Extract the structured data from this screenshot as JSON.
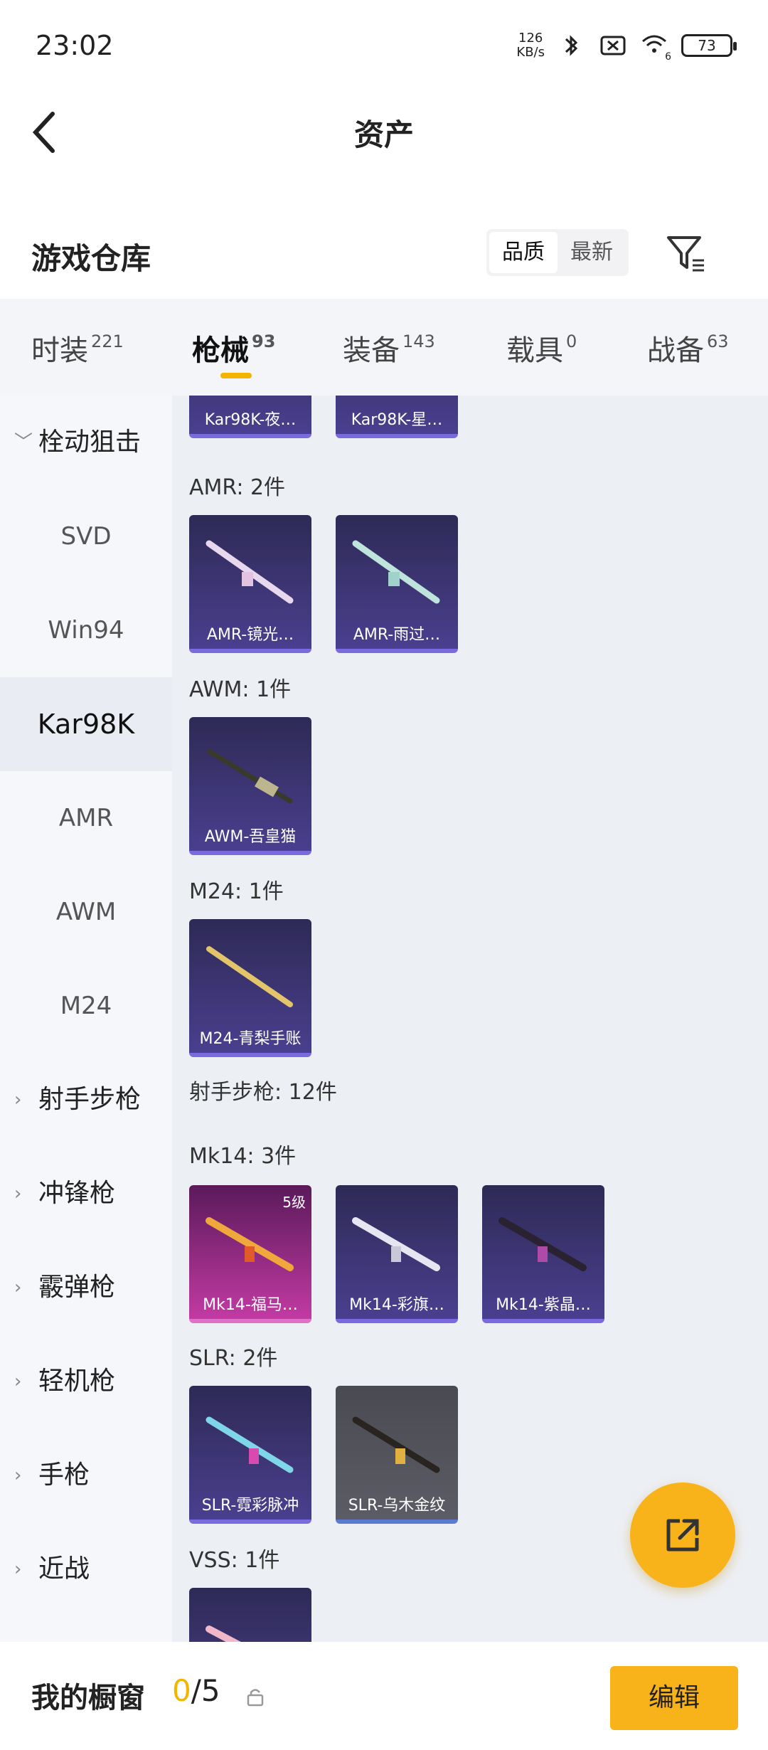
{
  "status_bar": {
    "time": "23:02",
    "net_speed_value": "126",
    "net_speed_unit": "KB/s",
    "wifi_suffix": "6",
    "battery": "73"
  },
  "nav": {
    "title": "资产"
  },
  "section": {
    "title": "游戏仓库",
    "sort_options": [
      "品质",
      "最新"
    ]
  },
  "tabs": [
    {
      "label": "时装",
      "count": "221"
    },
    {
      "label": "枪械",
      "count": "93"
    },
    {
      "label": "装备",
      "count": "143"
    },
    {
      "label": "载具",
      "count": "0"
    },
    {
      "label": "战备",
      "count": "63"
    }
  ],
  "sidebar": {
    "items": [
      {
        "label": "栓动狙击",
        "group": true
      },
      {
        "label": "SVD"
      },
      {
        "label": "Win94"
      },
      {
        "label": "Kar98K",
        "selected": true
      },
      {
        "label": "AMR"
      },
      {
        "label": "AWM"
      },
      {
        "label": "M24"
      },
      {
        "label": "射手步枪",
        "group": true
      },
      {
        "label": "冲锋枪",
        "group": true
      },
      {
        "label": "霰弹枪",
        "group": true
      },
      {
        "label": "轻机枪",
        "group": true
      },
      {
        "label": "手枪",
        "group": true
      },
      {
        "label": "近战",
        "group": true
      }
    ]
  },
  "content": {
    "groups": [
      {
        "label": "",
        "cards": [
          "Kar98K-夜…",
          "Kar98K-星…"
        ]
      },
      {
        "label": "AMR: 2件",
        "cards": [
          "AMR-镜光…",
          "AMR-雨过…"
        ]
      },
      {
        "label": "AWM: 1件",
        "cards": [
          "AWM-吾皇猫"
        ]
      },
      {
        "label": "M24: 1件",
        "cards": [
          "M24-青梨手账"
        ]
      },
      {
        "label": "射手步枪: 12件",
        "cards": []
      },
      {
        "label": "Mk14: 3件",
        "cards": [
          "Mk14-福马…",
          "Mk14-彩旗…",
          "Mk14-紫晶…"
        ],
        "first_card_level": "5级"
      },
      {
        "label": "SLR: 2件",
        "cards": [
          "SLR-霓彩脉冲",
          "SLR-乌木金纹"
        ]
      },
      {
        "label": "VSS: 1件",
        "cards": [
          ""
        ]
      }
    ]
  },
  "bottom": {
    "title": "我的橱窗",
    "count_current": "0",
    "count_total": "/5",
    "edit_label": "编辑"
  },
  "colors": {
    "accent": "#f5b400",
    "button": "#f8b21a"
  }
}
